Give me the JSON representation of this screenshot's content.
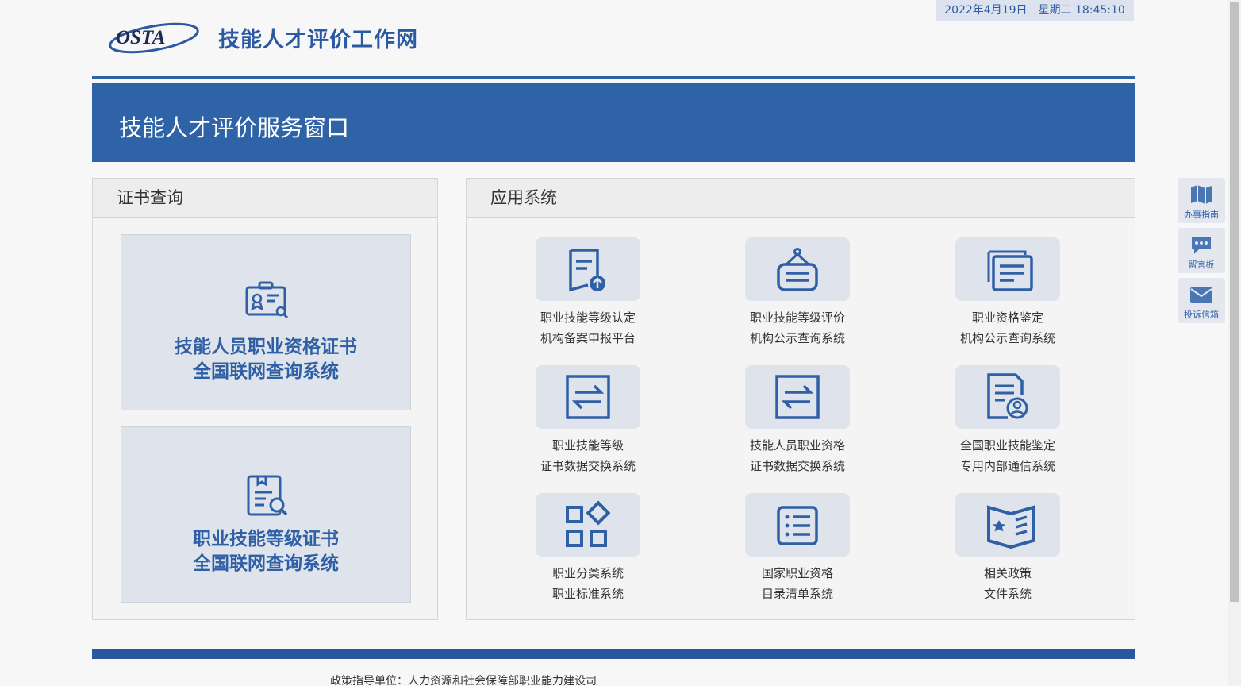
{
  "header": {
    "date": "2022年4月19日",
    "weekday_time": "星期二 18:45:10",
    "logo_text": "OSTA",
    "site_title": "技能人才评价工作网"
  },
  "banner": {
    "title": "技能人才评价服务窗口"
  },
  "certificate_panel": {
    "title": "证书查询",
    "items": [
      {
        "line1": "技能人员职业资格证书",
        "line2": "全国联网查询系统",
        "icon": "certificate-search-icon"
      },
      {
        "line1": "职业技能等级证书",
        "line2": "全国联网查询系统",
        "icon": "clipboard-search-icon"
      }
    ]
  },
  "app_panel": {
    "title": "应用系统",
    "items": [
      {
        "line1": "职业技能等级认定",
        "line2": "机构备案申报平台",
        "icon": "document-upload-icon"
      },
      {
        "line1": "职业技能等级评价",
        "line2": "机构公示查询系统",
        "icon": "hanging-sign-icon"
      },
      {
        "line1": "职业资格鉴定",
        "line2": "机构公示查询系统",
        "icon": "stacked-documents-icon"
      },
      {
        "line1": "职业技能等级",
        "line2": "证书数据交换系统",
        "icon": "exchange-arrows-icon"
      },
      {
        "line1": "技能人员职业资格",
        "line2": "证书数据交换系统",
        "icon": "exchange-arrows-icon"
      },
      {
        "line1": "全国职业技能鉴定",
        "line2": "专用内部通信系统",
        "icon": "document-user-icon"
      },
      {
        "line1": "职业分类系统",
        "line2": "职业标准系统",
        "icon": "category-grid-icon"
      },
      {
        "line1": "国家职业资格",
        "line2": "目录清单系统",
        "icon": "list-icon"
      },
      {
        "line1": "相关政策",
        "line2": "文件系统",
        "icon": "policy-book-icon"
      }
    ]
  },
  "side_tools": [
    {
      "label": "办事指南",
      "icon": "map-guide-icon"
    },
    {
      "label": "留言板",
      "icon": "chat-bubble-icon"
    },
    {
      "label": "投诉信箱",
      "icon": "mail-icon"
    }
  ],
  "footer": {
    "text": "政策指导单位：人力资源和社会保障部职业能力建设司"
  },
  "colors": {
    "brand_blue": "#2f63a8",
    "tile_bg": "#dfe4ec",
    "footer_blue": "#2a579f"
  }
}
